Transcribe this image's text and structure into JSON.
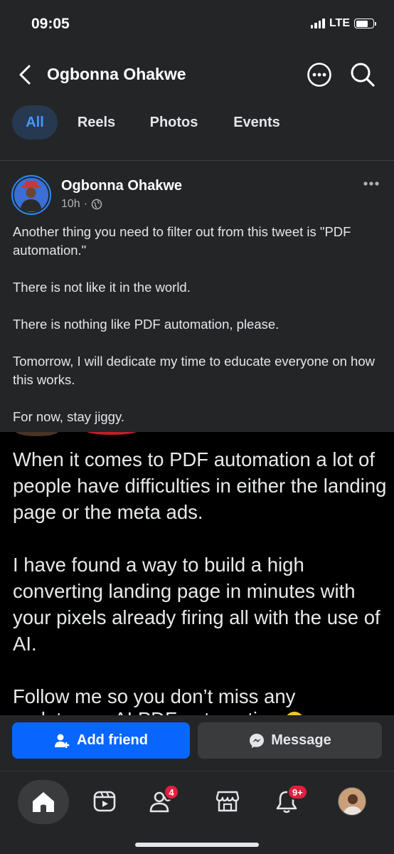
{
  "status_bar": {
    "time": "09:05",
    "network": "LTE",
    "battery_level": 0.72
  },
  "header": {
    "back_icon": "chevron-left-icon",
    "title": "Ogbonna Ohakwe",
    "more_icon": "more-circle-icon",
    "search_icon": "search-icon"
  },
  "tabs": [
    {
      "label": "All",
      "active": true
    },
    {
      "label": "Reels",
      "active": false
    },
    {
      "label": "Photos",
      "active": false
    },
    {
      "label": "Events",
      "active": false
    }
  ],
  "post": {
    "author": "Ogbonna Ohakwe",
    "time": "10h",
    "separator": "·",
    "privacy_icon": "globe-icon",
    "menu_icon": "more-horizontal-icon",
    "paragraphs": [
      "Another thing you need to filter out from this tweet is \"PDF automation.\"",
      "There is not like it in the world.",
      "There is nothing like PDF automation, please.",
      "Tomorrow, I will dedicate my time to educate everyone on how this works.",
      "For now, stay jiggy."
    ],
    "image_text": {
      "paragraphs": [
        "When it comes to PDF automation a lot of people have difficulties in either the landing page or the meta ads.",
        "I have found a way to build a high converting landing page in minutes with your pixels already firing all with the use of AI.",
        "Follow me so you don’t miss any"
      ],
      "cut_line": "updates on AI PDF automation"
    }
  },
  "actions": {
    "add_friend_label": "Add friend",
    "add_friend_icon": "add-person-icon",
    "message_label": "Message",
    "message_icon": "messenger-icon"
  },
  "bottom_nav": {
    "items": [
      {
        "name": "home",
        "icon": "home-icon",
        "active": true
      },
      {
        "name": "video",
        "icon": "video-icon"
      },
      {
        "name": "friends",
        "icon": "friends-icon",
        "badge": "4"
      },
      {
        "name": "marketplace",
        "icon": "marketplace-icon"
      },
      {
        "name": "notifications",
        "icon": "bell-icon",
        "badge": "9+"
      },
      {
        "name": "profile",
        "icon": "profile-avatar"
      }
    ]
  },
  "colors": {
    "background": "#242526",
    "accent": "#0866ff",
    "active_tab_bg": "#263951",
    "active_tab_text": "#4599ff",
    "badge": "#e41e3f"
  }
}
